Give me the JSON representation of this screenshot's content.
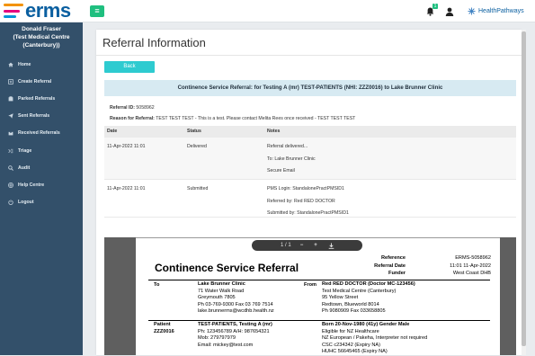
{
  "header": {
    "logo_text": "erms",
    "notification_count": "1",
    "healthpathways_label": "HealthPathways"
  },
  "sidebar": {
    "user_name": "Donald Fraser",
    "org_line1": "(Test Medical Centre",
    "org_line2": "(Canterbury))",
    "items": [
      {
        "label": "Home",
        "icon": "home-icon"
      },
      {
        "label": "Create Referral",
        "icon": "create-icon"
      },
      {
        "label": "Parked Referrals",
        "icon": "parked-icon"
      },
      {
        "label": "Sent Referrals",
        "icon": "sent-icon"
      },
      {
        "label": "Received Referrals",
        "icon": "received-icon"
      },
      {
        "label": "Triage",
        "icon": "triage-icon"
      },
      {
        "label": "Audit",
        "icon": "search-icon"
      },
      {
        "label": "Help Centre",
        "icon": "help-icon"
      },
      {
        "label": "Logout",
        "icon": "power-icon"
      }
    ]
  },
  "main": {
    "title": "Referral Information",
    "back_label": "Back",
    "banner": "Continence Service Referral: for Testing A (mr) TEST-PATIENTS (NHI: ZZZ0016) to Lake Brunner Clinic",
    "referral_id_label": "Referral ID:",
    "referral_id": "5058962",
    "reason_label": "Reason for Referral:",
    "reason": "TEST TEST TEST - This is a test. Please contact Melita Rees once received - TEST TEST TEST",
    "table": {
      "headers": [
        "Date",
        "Status",
        "Notes"
      ],
      "rows": [
        {
          "date": "11-Apr-2022 11:01",
          "status": "Delivered",
          "notes": [
            "Referral delivered...",
            "To: Lake Brunner Clinic",
            "Secure Email"
          ]
        },
        {
          "date": "11-Apr-2022 11:01",
          "status": "Submitted",
          "notes": [
            "PMS Login: StandalonePractPMSID1",
            "Referred by: Red RED DOCTOR",
            "Submitted by: StandalonePractPMSID1"
          ]
        }
      ]
    }
  },
  "viewer": {
    "page_indicator": "1 / 1",
    "zoom_out": "−",
    "zoom_in": "+",
    "doc": {
      "title": "Continence Service Referral",
      "meta": [
        {
          "k": "Reference",
          "v": "ERMS-5058962"
        },
        {
          "k": "Referral Date",
          "v": "11:01 11-Apr-2022"
        },
        {
          "k": "Funder",
          "v": "West Coast DHB"
        }
      ],
      "to_label": "To",
      "to_lines": [
        "Lake Brunner Clinic",
        "71 Water Walk Road",
        "Greymouth 7805",
        "Ph 03-769-9300    Fax 03 769 7514",
        "lake.brunnerms@wcdhb.health.nz"
      ],
      "from_label": "From",
      "from_lines": [
        "Red RED DOCTOR (Doctor MC-123456)",
        "Test Medical Centre (Canterbury)",
        "95 Yellow Street",
        "Redtown, Blueworld 8014",
        "Ph 9080909    Fax 033658805"
      ],
      "patient_label": "Patient",
      "patient_nhi": "ZZZ0016",
      "patient_lines": [
        "TEST-PATIENTS, Testing A (mr)",
        "Ph: 123456789  A/H: 987654321",
        "Mob: 279797979",
        "Email: mickey@test.com"
      ],
      "born_lines": [
        "Born 20-Nov-1980 (41y) Gender Male",
        "Eligible for NZ Healthcare",
        "NZ European / Pakeha, Interpreter not required",
        "CSC c234342 (Expiry NA)",
        "HUHC 56645465 (Expiry NA)"
      ]
    }
  }
}
